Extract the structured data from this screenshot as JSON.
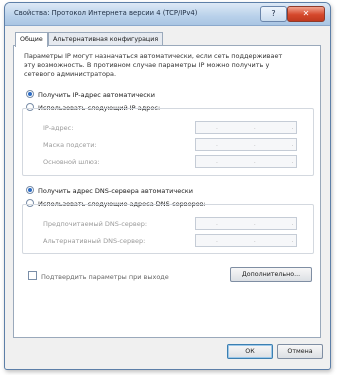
{
  "window": {
    "title": "Свойства: Протокол Интернета версии 4 (TCP/IPv4)",
    "help_label": "?",
    "close_label": "✕"
  },
  "tabs": [
    {
      "label": "Общие"
    },
    {
      "label": "Альтернативная конфигурация"
    }
  ],
  "intro_text": "Параметры IP могут назначаться автоматически, если сеть поддерживает эту возможность. В противном случае параметры IP можно получить у сетевого администратора.",
  "ip": {
    "auto_label": "Получить IP-адрес автоматически",
    "manual_label": "Использовать следующий IP-адрес:",
    "fields": [
      {
        "label": "IP-адрес:",
        "value": ". . ."
      },
      {
        "label": "Маска подсети:",
        "value": ". . ."
      },
      {
        "label": "Основной шлюз:",
        "value": ". . ."
      }
    ]
  },
  "dns": {
    "auto_label": "Получить адрес DNS-сервера автоматически",
    "manual_label": "Использовать следующие адреса DNS-серверов:",
    "fields": [
      {
        "label": "Предпочитаемый DNS-сервер:",
        "value": ". . ."
      },
      {
        "label": "Альтернативный DNS-сервер:",
        "value": ". . ."
      }
    ]
  },
  "validate_label": "Подтвердить параметры при выходе",
  "advanced_label": "Дополнительно...",
  "ok_label": "ОК",
  "cancel_label": "Отмена"
}
